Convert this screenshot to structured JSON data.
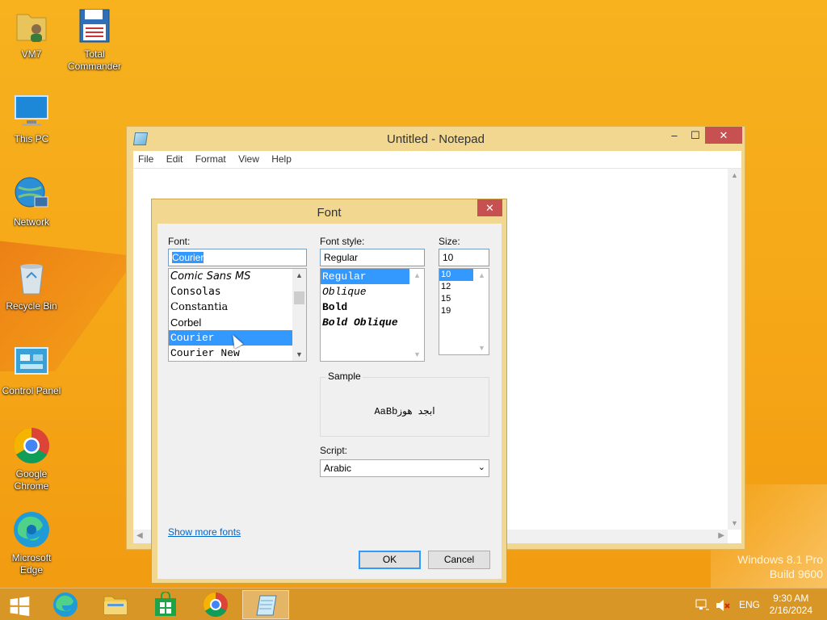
{
  "desktop": {
    "icons": [
      {
        "label": "VM7",
        "icon": "folder-user-icon"
      },
      {
        "label": "Total Commander",
        "icon": "floppy-disk-icon"
      },
      {
        "label": "This PC",
        "icon": "computer-icon"
      },
      {
        "label": "Network",
        "icon": "network-globe-icon"
      },
      {
        "label": "Recycle Bin",
        "icon": "recycle-bin-icon"
      },
      {
        "label": "Control Panel",
        "icon": "control-panel-icon"
      },
      {
        "label": "Google Chrome",
        "icon": "chrome-icon"
      },
      {
        "label": "Microsoft Edge",
        "icon": "edge-icon"
      }
    ],
    "watermark": {
      "line1": "Windows 8.1 Pro",
      "line2": "Build 9600"
    }
  },
  "notepad": {
    "title": "Untitled - Notepad",
    "menu": [
      "File",
      "Edit",
      "Format",
      "View",
      "Help"
    ],
    "controls": {
      "minimize": "–",
      "maximize": "☐",
      "close": "✕"
    }
  },
  "font_dialog": {
    "title": "Font",
    "close": "✕",
    "font_label": "Font:",
    "font_value": "Courier",
    "fonts": [
      {
        "name": "Comic Sans MS",
        "selected": false
      },
      {
        "name": "Consolas",
        "selected": false
      },
      {
        "name": "Constantia",
        "selected": false
      },
      {
        "name": "Corbel",
        "selected": false
      },
      {
        "name": "Courier",
        "selected": true
      },
      {
        "name": "Courier New",
        "selected": false
      }
    ],
    "style_label": "Font style:",
    "style_value": "Regular",
    "styles": [
      {
        "name": "Regular",
        "selected": true
      },
      {
        "name": "Oblique",
        "selected": false
      },
      {
        "name": "Bold",
        "selected": false
      },
      {
        "name": "Bold Oblique",
        "selected": false
      }
    ],
    "size_label": "Size:",
    "size_value": "10",
    "sizes": [
      {
        "name": "10",
        "selected": true
      },
      {
        "name": "12",
        "selected": false
      },
      {
        "name": "15",
        "selected": false
      },
      {
        "name": "19",
        "selected": false
      }
    ],
    "sample_label": "Sample",
    "sample_text": "AaBbابجد هوز",
    "script_label": "Script:",
    "script_value": "Arabic",
    "show_more": "Show more fonts",
    "ok": "OK",
    "cancel": "Cancel"
  },
  "taskbar": {
    "items": [
      "start-icon",
      "edge-icon",
      "file-explorer-icon",
      "store-icon",
      "chrome-icon",
      "notepad-icon"
    ],
    "language": "ENG",
    "time": "9:30 AM",
    "date": "2/16/2024"
  }
}
